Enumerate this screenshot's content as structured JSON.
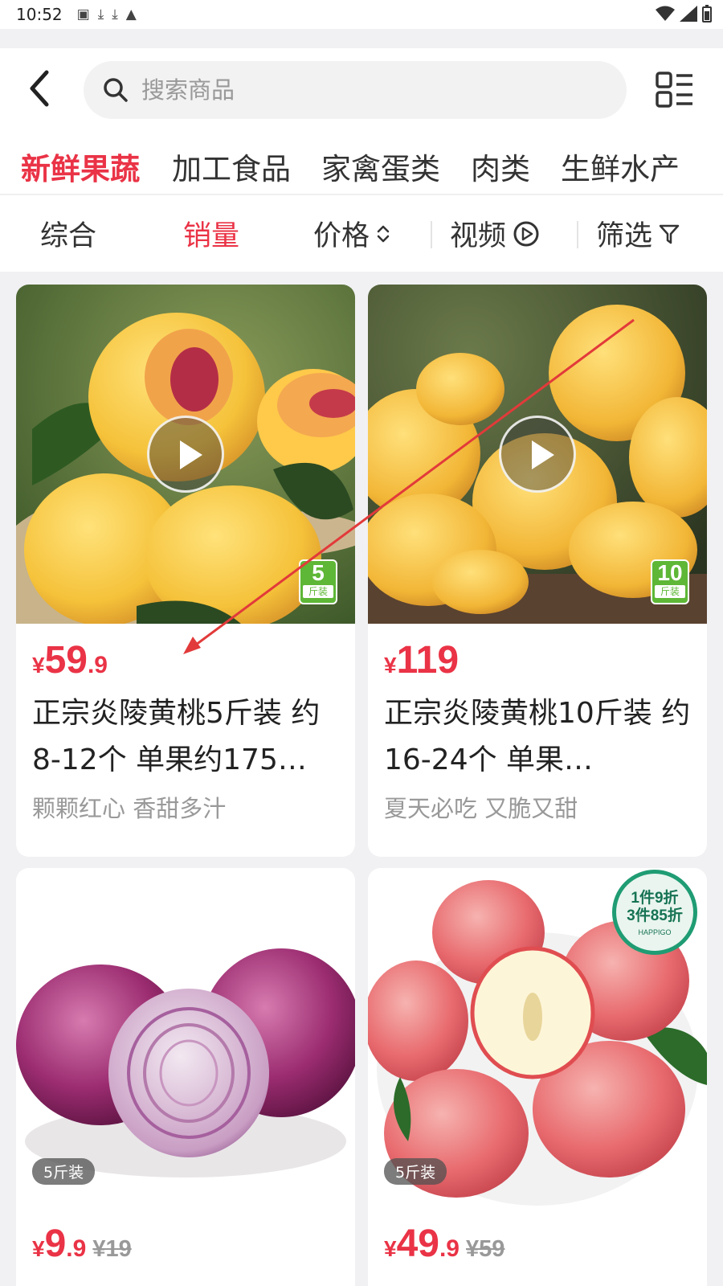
{
  "status_bar": {
    "time": "10:52"
  },
  "search": {
    "placeholder": "搜索商品"
  },
  "categories": [
    "新鲜果蔬",
    "加工食品",
    "家禽蛋类",
    "肉类",
    "生鲜水产"
  ],
  "sort": {
    "items": [
      "综合",
      "销量",
      "价格",
      "视频",
      "筛选"
    ],
    "active": "销量"
  },
  "colors": {
    "accent": "#ea3346",
    "badge_green": "#5eb736",
    "promo_green": "#1f9c73"
  },
  "products": [
    {
      "price_symbol": "¥",
      "price_int": "59",
      "price_dec": ".9",
      "price_orig": "",
      "title": "正宗炎陵黄桃5斤装 约8-12个 单果约175…",
      "subtitle": "颗颗红心 香甜多汁",
      "weight_badge": {
        "num": "5",
        "unit": "斤装"
      }
    },
    {
      "price_symbol": "¥",
      "price_int": "119",
      "price_dec": "",
      "price_orig": "",
      "title": "正宗炎陵黄桃10斤装 约16-24个 单果…",
      "subtitle": "夏天必吃 又脆又甜",
      "weight_badge": {
        "num": "10",
        "unit": "斤装"
      }
    },
    {
      "price_symbol": "¥",
      "price_int": "9",
      "price_dec": ".9",
      "price_orig": "¥19",
      "pill_badge": "5斤装"
    },
    {
      "price_symbol": "¥",
      "price_int": "49",
      "price_dec": ".9",
      "price_orig": "¥59",
      "pill_badge": "5斤装",
      "promo_badge": {
        "line1": "1件9折",
        "line2": "3件85折",
        "line3": "HAPPIGO"
      }
    }
  ]
}
